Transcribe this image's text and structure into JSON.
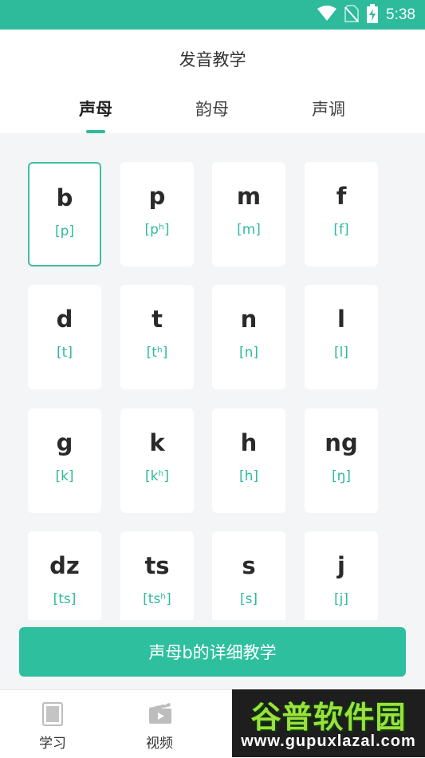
{
  "status_bar": {
    "time": "5:38",
    "icons": [
      "wifi-icon",
      "no-sim-icon",
      "battery-charging-icon"
    ]
  },
  "header": {
    "title": "发音教学",
    "tabs": [
      {
        "label": "声母",
        "active": true
      },
      {
        "label": "韵母",
        "active": false
      },
      {
        "label": "声调",
        "active": false
      }
    ]
  },
  "initials": [
    {
      "letter": "b",
      "ipa": "[p]",
      "selected": true
    },
    {
      "letter": "p",
      "ipa": "[pʰ]"
    },
    {
      "letter": "m",
      "ipa": "[m]"
    },
    {
      "letter": "f",
      "ipa": "[f]"
    },
    {
      "letter": "d",
      "ipa": "[t]"
    },
    {
      "letter": "t",
      "ipa": "[tʰ]"
    },
    {
      "letter": "n",
      "ipa": "[n]"
    },
    {
      "letter": "l",
      "ipa": "[l]"
    },
    {
      "letter": "g",
      "ipa": "[k]"
    },
    {
      "letter": "k",
      "ipa": "[kʰ]"
    },
    {
      "letter": "h",
      "ipa": "[h]"
    },
    {
      "letter": "ng",
      "ipa": "[ŋ]"
    },
    {
      "letter": "dz",
      "ipa": "[ts]"
    },
    {
      "letter": "ts",
      "ipa": "[tsʰ]"
    },
    {
      "letter": "s",
      "ipa": "[s]"
    },
    {
      "letter": "j",
      "ipa": "[j]"
    }
  ],
  "action_button": {
    "label": "声母b的详细教学"
  },
  "bottom_nav": {
    "items": [
      {
        "label": "学习",
        "icon": "book-icon"
      },
      {
        "label": "视频",
        "icon": "clapperboard-icon"
      }
    ]
  },
  "watermark": {
    "title": "谷普软件园",
    "url": "www.gupuxlazal.com"
  },
  "colors": {
    "accent": "#2dbb9c",
    "background": "#f4f5f7"
  }
}
